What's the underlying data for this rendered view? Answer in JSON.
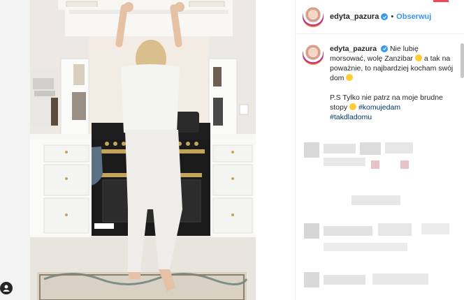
{
  "post": {
    "username": "edyta_pazura",
    "separator": "•",
    "follow_label": "Obserwuj",
    "caption_line1": "Nie lubię morsować, wolę Zanzibar",
    "caption_line2": "a tak na poważnie, to najbardziej kocham swój dom",
    "caption_line3": "P.S Tylko nie patrz na moje brudne stopy",
    "hashtag1": "#komujedam",
    "hashtag2": "#takdladomu"
  },
  "icons": {
    "verified": "verified-badge-icon",
    "user": "user-icon"
  },
  "colors": {
    "link": "#3897f0",
    "hashtag": "#00376b",
    "text": "#262626"
  }
}
